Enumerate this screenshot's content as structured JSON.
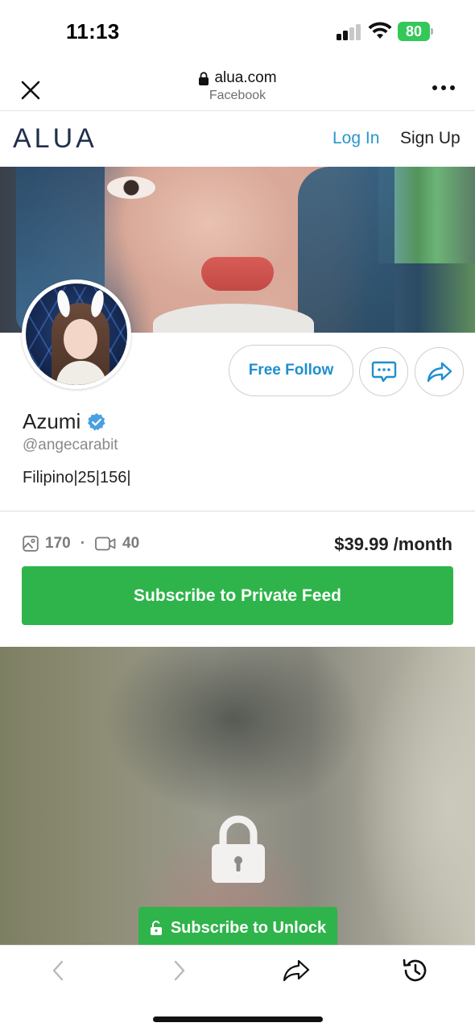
{
  "status_bar": {
    "time": "11:13",
    "battery": "80"
  },
  "browser": {
    "domain": "alua.com",
    "source": "Facebook",
    "close_icon": "close-icon",
    "more_icon": "more-icon"
  },
  "site_nav": {
    "logo": "ALUA",
    "login": "Log In",
    "signup": "Sign Up"
  },
  "profile": {
    "name": "Azumi",
    "handle": "@angecarabit",
    "bio": "Filipino|25|156|",
    "follow_label": "Free Follow",
    "message_icon": "message-icon",
    "share_icon": "share-icon"
  },
  "stats": {
    "photos": "170",
    "separator": "·",
    "videos": "40",
    "price": "$39.99 /month"
  },
  "subscribe": {
    "label": "Subscribe to Private Feed"
  },
  "locked_post": {
    "unlock_label": "Subscribe to Unlock"
  },
  "colors": {
    "accent_blue": "#1f8fd0",
    "green": "#2eb44a",
    "logo_navy": "#1f2f4b"
  }
}
